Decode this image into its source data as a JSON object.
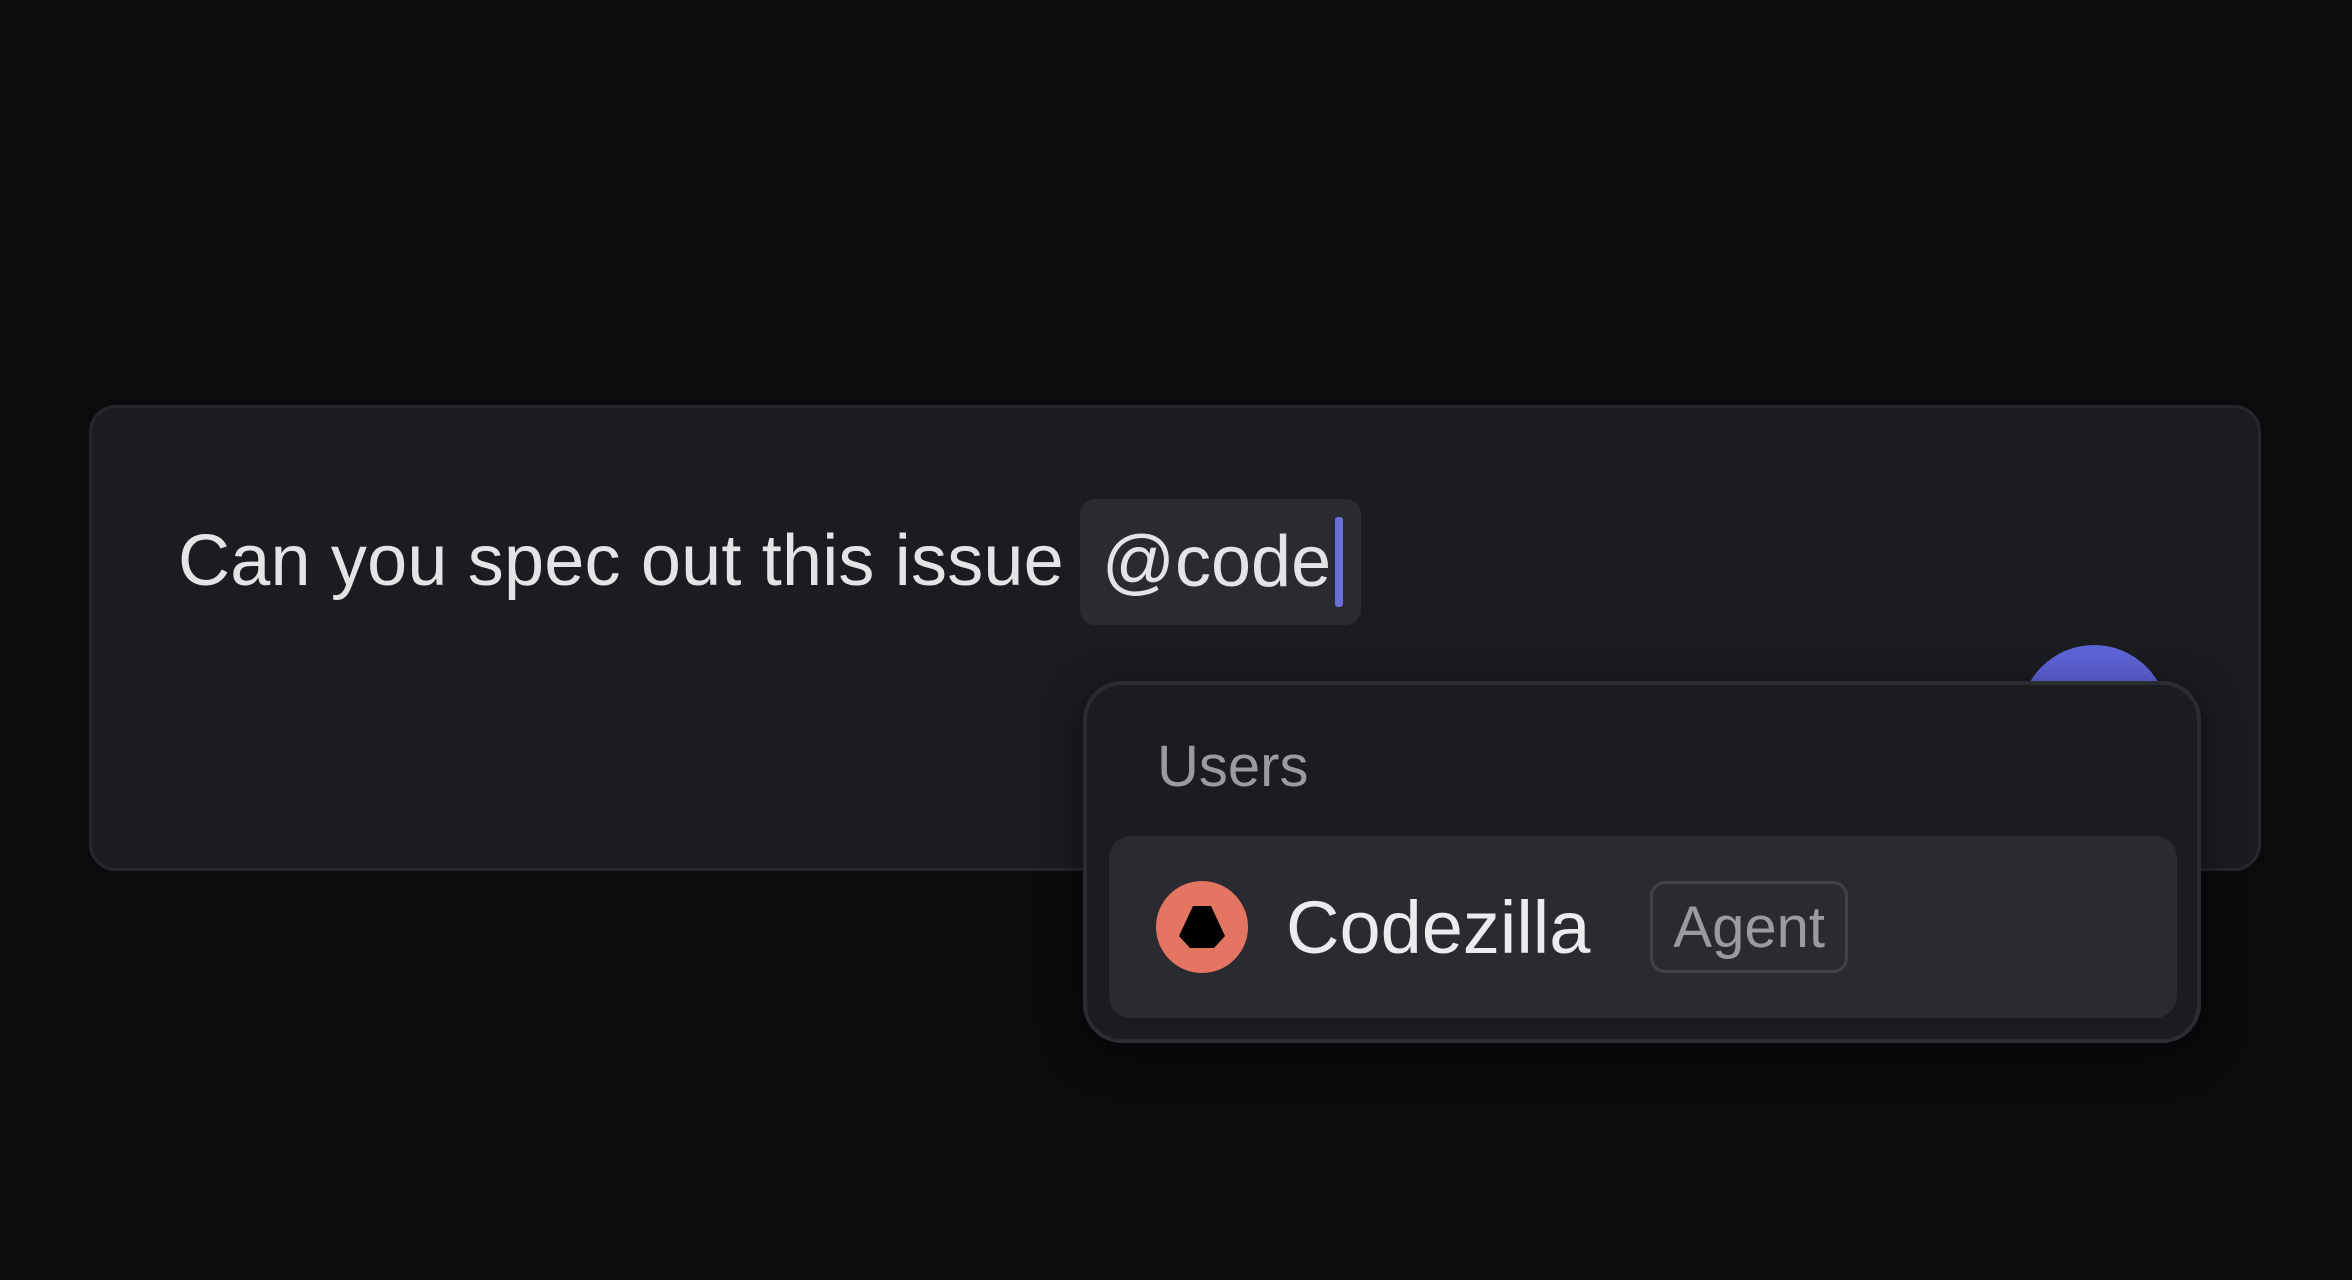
{
  "composer": {
    "text": "Can you spec out this issue",
    "mention": "@code"
  },
  "popup": {
    "section_label": "Users",
    "items": [
      {
        "name": "Codezilla",
        "badge": "Agent",
        "avatar_icon": "codezilla-logo-icon",
        "avatar_color": "#e57563"
      }
    ]
  },
  "colors": {
    "background": "#0a0b0d",
    "accent": "#5e63d6",
    "caret": "#6b70d8"
  }
}
